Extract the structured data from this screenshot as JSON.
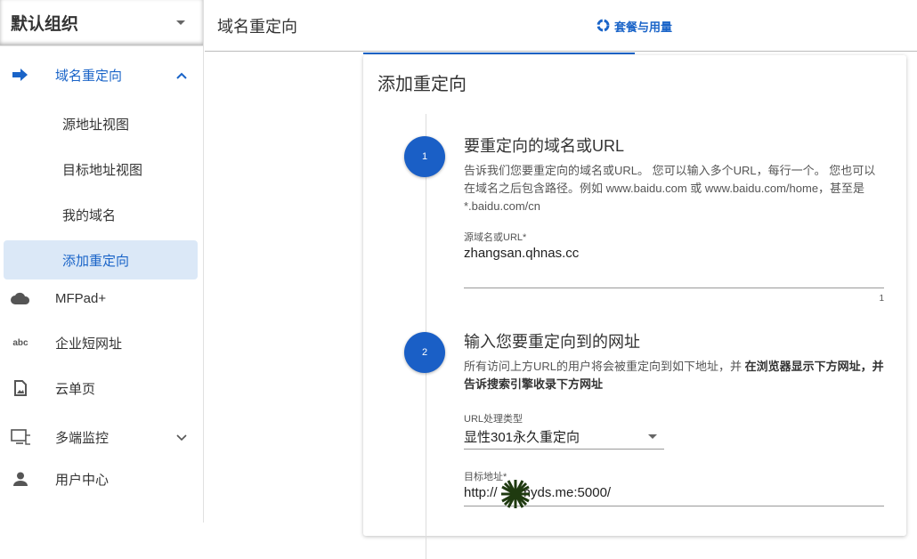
{
  "sidebar": {
    "org": "默认组织",
    "items": [
      {
        "label": "域名重定向",
        "icon": "arrow-right-icon"
      },
      {
        "label": "源地址视图"
      },
      {
        "label": "目标地址视图"
      },
      {
        "label": "我的域名"
      },
      {
        "label": "添加重定向"
      },
      {
        "label": "MFPad+",
        "icon": "cloud-icon"
      },
      {
        "label": "企业短网址",
        "icon": "abc-icon"
      },
      {
        "label": "云单页",
        "icon": "page-image-icon"
      },
      {
        "label": "多端监控",
        "icon": "devices-icon"
      },
      {
        "label": "用户中心",
        "icon": "person-icon"
      }
    ]
  },
  "header": {
    "title": "域名重定向",
    "plan": "套餐与用量"
  },
  "colors": {
    "accent": "#1a64c8",
    "selected_bg": "#dbe8f7"
  },
  "card": {
    "title": "添加重定向",
    "step1": {
      "num": "1",
      "title": "要重定向的域名或URL",
      "desc": "告诉我们您要重定向的域名或URL。 您可以输入多个URL，每行一个。 您也可以在域名之后包含路径。例如 www.baidu.com 或 www.baidu.com/home，甚至是 *.baidu.com/cn",
      "field_label": "源域名或URL*",
      "field_value": "zhangsan.qhnas.cc",
      "counter": "1"
    },
    "step2": {
      "num": "2",
      "title": "输入您要重定向到的网址",
      "desc": "所有访问上方URL的用户将会被重定向到如下地址，并 ",
      "desc_bold": "在浏览器显示下方网址，并告诉搜索引擎收录下方网址",
      "type_label": "URL处理类型",
      "type_value": "显性301永久重定向",
      "target_label": "目标地址*",
      "target_value": "http://     .myds.me:5000/"
    }
  }
}
